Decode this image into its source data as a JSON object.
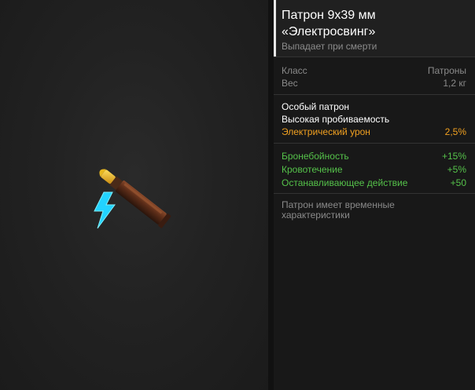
{
  "item": {
    "title_line1": "Патрон 9x39 мм",
    "title_line2": "«Электросвинг»",
    "drop_note": "Выпадает при смерти"
  },
  "info": [
    {
      "label": "Класс",
      "value": "Патроны"
    },
    {
      "label": "Вес",
      "value": "1,2 кг"
    }
  ],
  "special": {
    "line1": "Особый патрон",
    "line2": "Высокая пробиваемость",
    "damage_label": "Электрический урон",
    "damage_value": "2,5%"
  },
  "stats": [
    {
      "label": "Бронебойность",
      "value": "+15%"
    },
    {
      "label": "Кровотечение",
      "value": "+5%"
    },
    {
      "label": "Останавливающее действие",
      "value": "+50"
    }
  ],
  "footer_note": "Патрон имеет временные характеристики",
  "colors": {
    "accent_orange": "#f0a020",
    "stat_green": "#55c24a",
    "lightning_cyan": "#22d3ff"
  },
  "icons": {
    "item": "bullet-icon",
    "effect": "lightning-icon"
  }
}
